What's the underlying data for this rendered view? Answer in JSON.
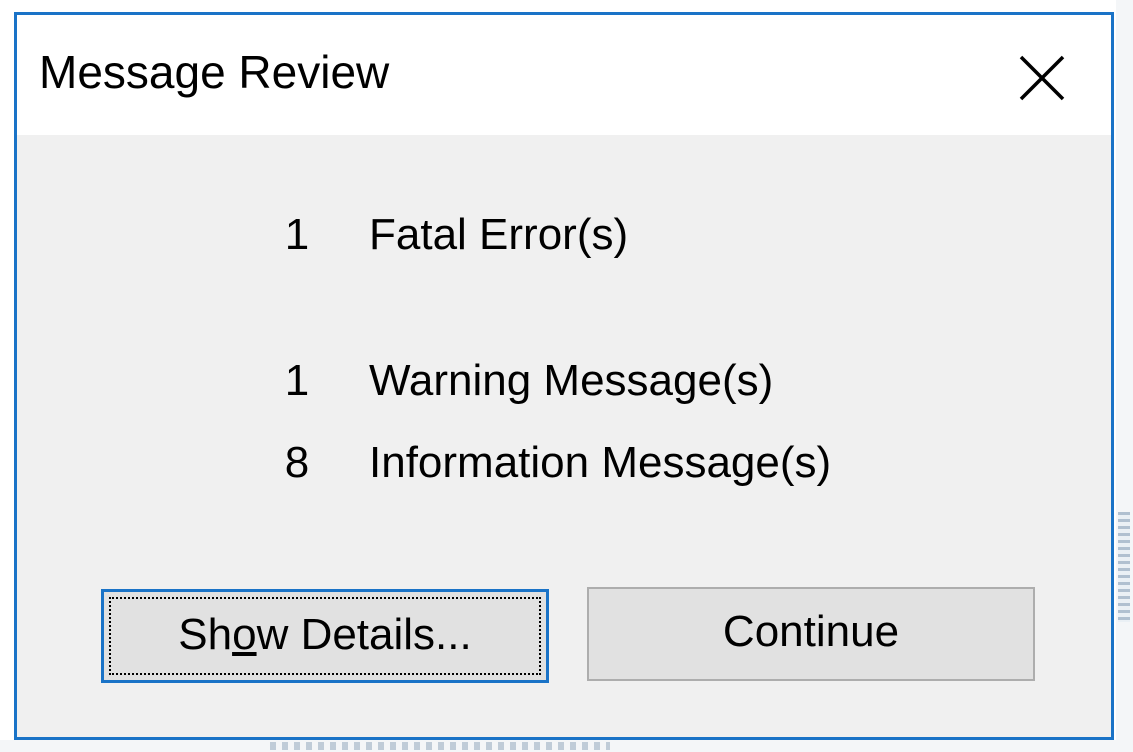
{
  "dialog": {
    "title": "Message Review",
    "close_icon": "close-icon",
    "accent_color": "#1a73c7"
  },
  "messages": [
    {
      "count": "1",
      "label": "Fatal Error(s)"
    },
    {
      "count": "1",
      "label": "Warning Message(s)"
    },
    {
      "count": "8",
      "label": "Information Message(s)"
    }
  ],
  "buttons": {
    "details": {
      "prefix": "Sh",
      "mnemonic": "o",
      "suffix": "w Details..."
    },
    "continue_label": "Continue"
  }
}
